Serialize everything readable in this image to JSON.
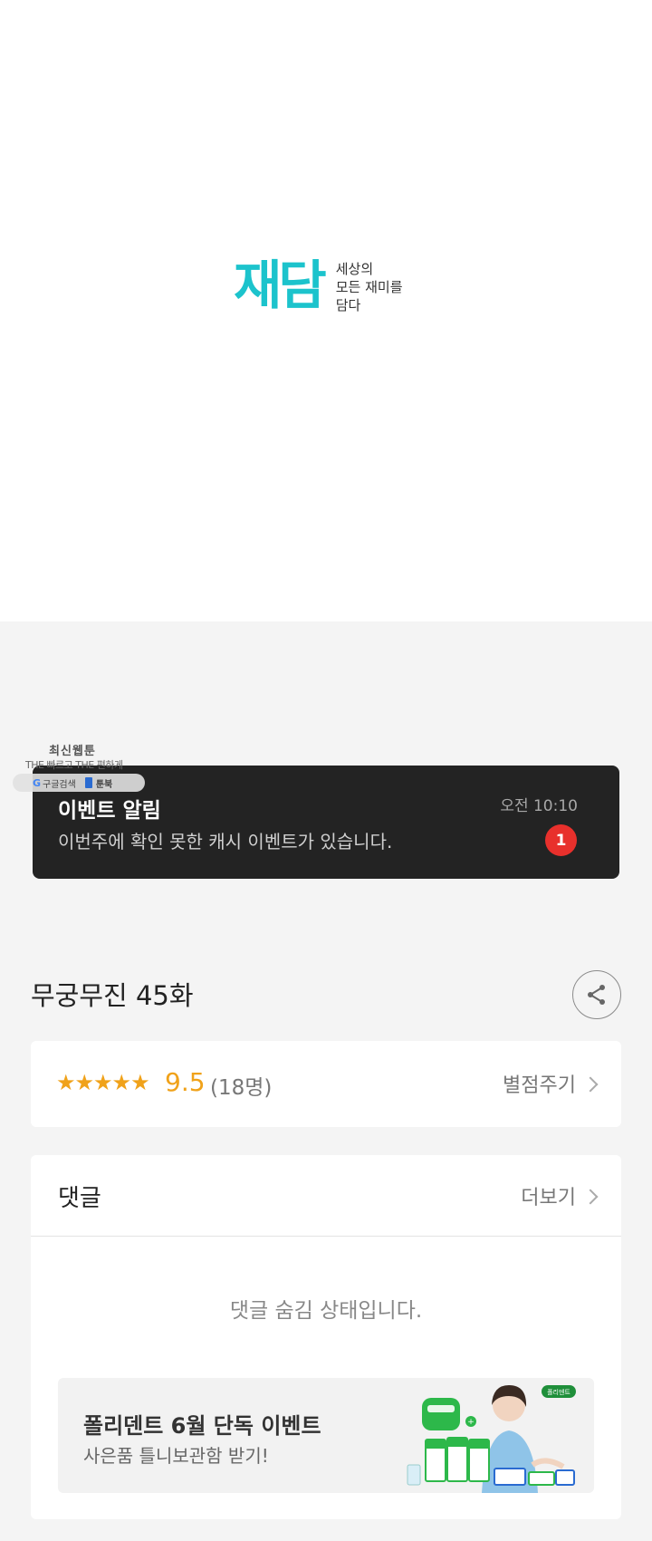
{
  "logo": {
    "mark": "재담",
    "tagline_1": "세상의",
    "tagline_2": "모든 재미를",
    "tagline_3": "담다"
  },
  "widget": {
    "title": "최신웹툰",
    "subtitle": "THE 빠르고 THE 편하게",
    "search_label": "구글검색",
    "toon_label": "툰북"
  },
  "notification": {
    "title": "이벤트 알림",
    "body": "이번주에 확인 못한 캐시 이벤트가 있습니다.",
    "time": "오전 10:10",
    "badge": "1"
  },
  "episode": {
    "title": "무궁무진 45화"
  },
  "rating": {
    "stars": "★★★★★",
    "score": "9.5",
    "count": "(18명)",
    "action": "별점주기"
  },
  "comments": {
    "title": "댓글",
    "more": "더보기",
    "hidden_message": "댓글 숨김 상태입니다."
  },
  "ad": {
    "title": "폴리덴트 6월 단독 이벤트",
    "subtitle": "사은품 틀니보관함 받기!",
    "brand_tag": "폴리덴트"
  },
  "colors": {
    "brand_teal": "#1cc3cc",
    "star_orange": "#f0a21a",
    "badge_red": "#e8302c",
    "notification_bg": "#232323"
  }
}
